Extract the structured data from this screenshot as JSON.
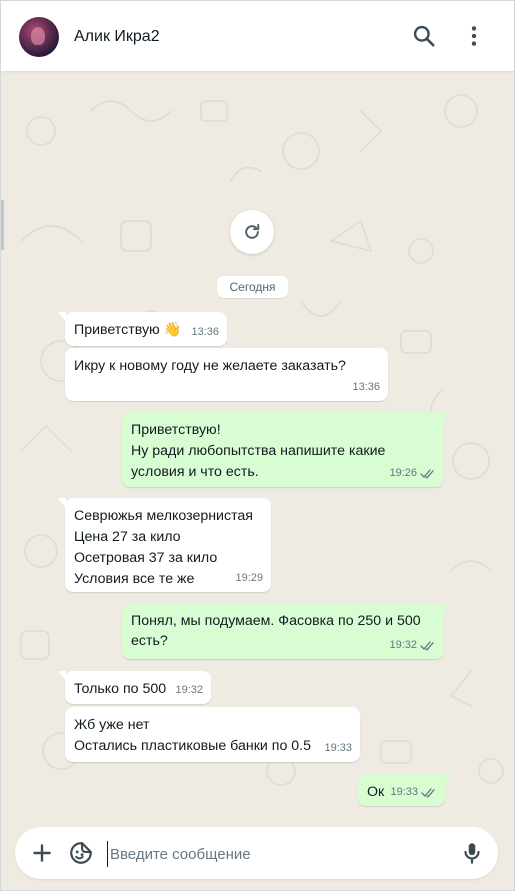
{
  "header": {
    "contact_name": "Алик Икра2",
    "avatar_icon": "avatar-photo",
    "search_icon": "search-icon",
    "menu_icon": "more-vertical-icon"
  },
  "chat": {
    "date_chip": "Сегодня",
    "refresh_icon": "refresh-icon",
    "messages": [
      {
        "dir": "in",
        "text": "Приветствую 👋",
        "time": "13:36"
      },
      {
        "dir": "in",
        "text": "Икру к новому году не желаете заказать?",
        "time": "13:36"
      },
      {
        "dir": "out",
        "text": "Приветствую!\nНу ради любопытства напишите какие условия и что есть.",
        "time": "19:26",
        "status": "read"
      },
      {
        "dir": "in",
        "text": "Севрюжья мелкозернистая\nЦена 27 за кило\nОсетровая 37 за кило\nУсловия все те же",
        "time": "19:29"
      },
      {
        "dir": "out",
        "text": "Понял, мы подумаем. Фасовка по 250 и 500 есть?",
        "time": "19:32",
        "status": "read"
      },
      {
        "dir": "in",
        "text": "Только по 500",
        "time": "19:32"
      },
      {
        "dir": "in",
        "text": "Жб уже нет\nОстались пластиковые банки по 0.5",
        "time": "19:33"
      },
      {
        "dir": "out",
        "text": "Ок",
        "time": "19:33",
        "status": "read"
      }
    ]
  },
  "composer": {
    "placeholder": "Введите сообщение",
    "value": "",
    "attach_icon": "plus-icon",
    "sticker_icon": "sticker-icon",
    "mic_icon": "microphone-icon"
  },
  "colors": {
    "incoming": "#ffffff",
    "outgoing": "#d9fdd3",
    "background": "#efeae2",
    "read_ticks": "#667781"
  }
}
